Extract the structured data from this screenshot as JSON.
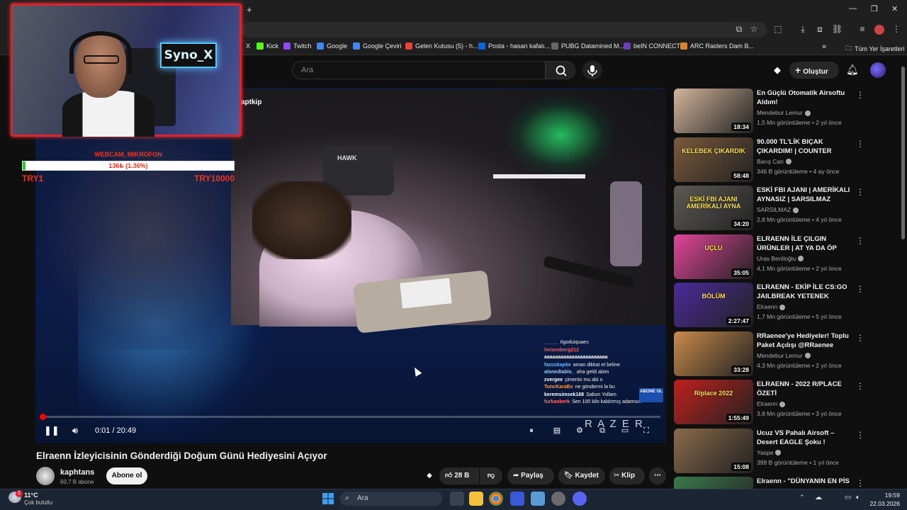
{
  "browser": {
    "bookmarks": [
      {
        "label": "X",
        "color": "#111111"
      },
      {
        "label": "Kick",
        "color": "#53fc18"
      },
      {
        "label": "Twitch",
        "color": "#9146ff"
      },
      {
        "label": "Google",
        "color": "#4285f4"
      },
      {
        "label": "Google Çeviri",
        "color": "#4285f4"
      },
      {
        "label": "Gelen Kutusu (5) - h...",
        "color": "#ea4335"
      },
      {
        "label": "Posta - hasan kafalı...",
        "color": "#0a64d6"
      },
      {
        "label": "PUBG Datamined M...",
        "color": "#666666"
      },
      {
        "label": "beIN CONNECT",
        "color": "#6a3fb5"
      },
      {
        "label": "ARC Raiders Dam B...",
        "color": "#d9822b"
      }
    ],
    "all_bookmarks": "Tüm Yer İşaretleri"
  },
  "header": {
    "search_placeholder": "Ara",
    "create_label": "Oluştur"
  },
  "webcam": {
    "sign_text": "Syno_X"
  },
  "donation": {
    "title": "WEBCAM, MIKROFON",
    "progress_text": "136₺ (1.36%)",
    "progress_fraction": 0.0136,
    "min_label": "TRY1",
    "max_label": "TRY10000"
  },
  "player": {
    "watermark": "aptkip",
    "time_display": "0:01 / 20:49",
    "progress_fraction": 0.001,
    "chat": [
      {
        "user": "_____",
        "msg": "ńgoduiquaeıı",
        "color": "#b58cff"
      },
      {
        "user": "heisenberg212",
        "msg": "",
        "color": "#ff5c5c"
      },
      {
        "user": "aaaaaaaaaaaaaaaaaaaaaaa",
        "msg": "",
        "color": "#ffffff"
      },
      {
        "user": "fazoskapke",
        "msg": "aman dikkat et beline",
        "color": "#6fb6ff"
      },
      {
        "user": "alonedIablo_",
        "msg": "aha geldi abim",
        "color": "#8bd3ff"
      },
      {
        "user": "zvergee",
        "msg": "çimento mu abi o",
        "color": "#ffffff"
      },
      {
        "user": "TuncKaraBx",
        "msg": "ne göndermi la bu",
        "color": "#ff9a3c"
      },
      {
        "user": "keremsimsek168",
        "msg": "Sabun Yollam",
        "color": "#ffffff"
      },
      {
        "user": "furkanberk",
        "msg": "Sen 100 kilo kaldırmış adamsın",
        "color": "#ff6b6b"
      }
    ],
    "abone_badge": "ABONE OL",
    "razer_text": "R A Z E R"
  },
  "video": {
    "title": "Elraenn İzleyicisinin Gönderdiği Doğum Günü Hediyesini Açıyor",
    "channel": "kaphtans",
    "subscribers": "60,7 B abone",
    "subscribe_label": "Abone ol",
    "likes": "28 B",
    "share_label": "Paylaş",
    "save_label": "Kaydet",
    "clip_label": "Klip"
  },
  "suggestions": [
    {
      "title": "En Güçlü Otomatik Airsoftu Aldım!",
      "channel": "Mendebur Lemur",
      "meta": "1,5 Mn görüntüleme • 2 yıl önce",
      "duration": "18:34",
      "thumb": "#d3b59a"
    },
    {
      "title": "90.000 TL'LİK BIÇAK ÇIKARDIM! | COUNTER STRIKE 2 KASA ...",
      "channel": "Barış Can",
      "meta": "346 B görüntüleme • 4 ay önce",
      "duration": "58:48",
      "thumb": "#7a5a3a",
      "overlay": "KELEBEK ÇIKARDIK"
    },
    {
      "title": "ESKİ FBI AJANI | AMERİKALI AYNASIZ | SARSILMAZ",
      "channel": "SARSILMAZ",
      "meta": "2,8 Mn görüntüleme • 4 yıl önce",
      "duration": "34:20",
      "thumb": "#5c5a54",
      "overlay": "ESKİ FBI AJANI AMERİKALI AYNA"
    },
    {
      "title": "ELRAENN İLE ÇILGIN ÜRÜNLER | AT YA DA ÖP",
      "channel": "Uras Benlioğlu",
      "meta": "4,1 Mn görüntüleme • 2 yıl önce",
      "duration": "35:05",
      "thumb": "#e2459a",
      "overlay": "UÇLU"
    },
    {
      "title": "ELRAENN - EKİP İLE CS:GO JAILBREAK YETENEK SİZSİNİ...",
      "channel": "Elraenn",
      "meta": "1,7 Mn görüntüleme • 5 yıl önce",
      "duration": "2:27:47",
      "thumb": "#4a2a9a",
      "overlay": "BÖLÜM"
    },
    {
      "title": "RRaenee'ye Hediyeler! Toplu Paket Açılışı @RRaenee",
      "channel": "Mendebur Lemur",
      "meta": "4,3 Mn görüntüleme • 2 yıl önce",
      "duration": "33:28",
      "thumb": "#c98a4a"
    },
    {
      "title": "ELRAENN - 2022 R/PLACE ÖZETİ",
      "channel": "Elraenn",
      "meta": "3,8 Mn görüntüleme • 3 yıl önce",
      "duration": "1:55:49",
      "thumb": "#c0201c",
      "overlay": "R/place 2022"
    },
    {
      "title": "Ucuz VS Pahalı Airsoft – Desert EAGLE Şoku !",
      "channel": "Yaspe",
      "meta": "399 B görüntüleme • 1 yıl önce",
      "duration": "15:08",
      "thumb": "#8a6a4a"
    },
    {
      "title": "Elraenn - \"DÜNYANIN EN PİS",
      "channel": "",
      "meta": "",
      "duration": "",
      "thumb": "#3a7a4a"
    }
  ],
  "taskbar": {
    "weather_temp": "11°C",
    "weather_desc": "Çok bulutlu",
    "search_placeholder": "Ara",
    "time": "19:59",
    "date": "22.03.2026",
    "weather_badge": "2"
  }
}
